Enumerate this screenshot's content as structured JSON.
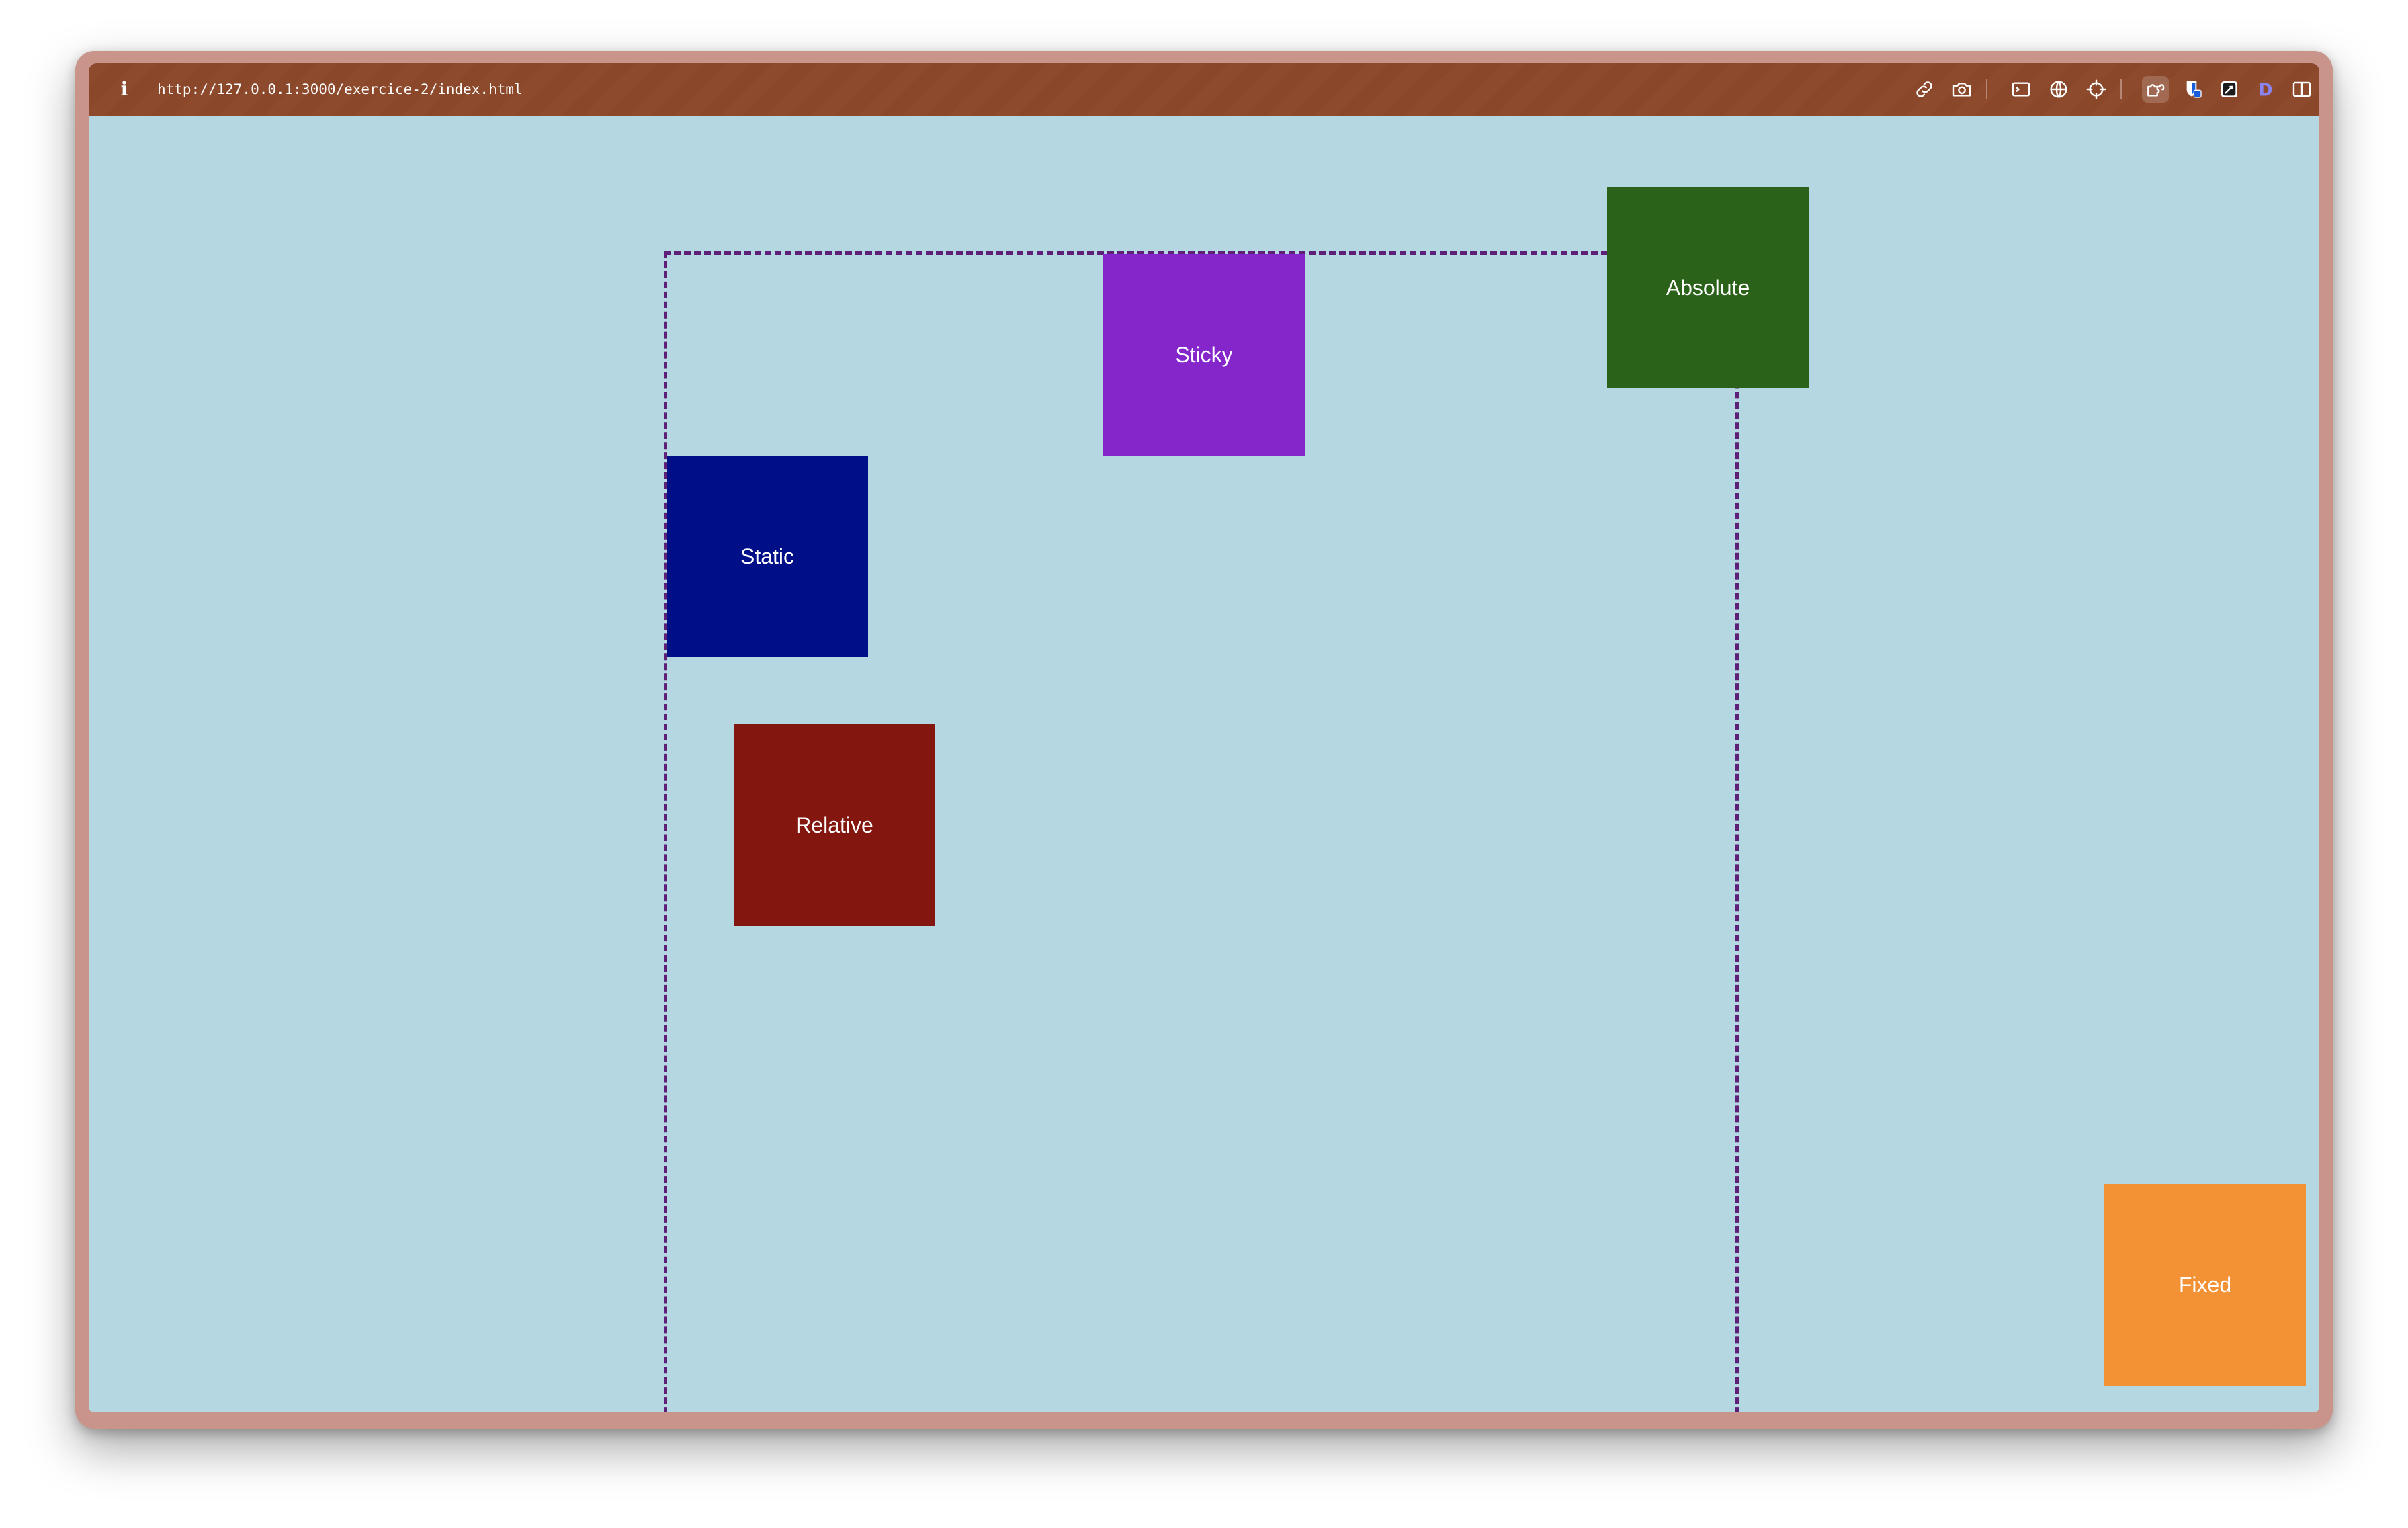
{
  "browser": {
    "url": "http://127.0.0.1:3000/exercice-2/index.html",
    "info_glyph": "i",
    "toolbar_icons": [
      "link-icon",
      "camera-icon",
      "terminal-icon",
      "globe-icon",
      "crosshair-icon",
      "extensions-icon",
      "bitwarden-icon",
      "editor-icon",
      "d-icon",
      "sidebar-icon"
    ],
    "d_icon_letter": "D",
    "toolbar_color": "#8e4a2c",
    "frame_color": "#c9948a"
  },
  "page": {
    "background": "#b5d7e2",
    "container_border_color": "#5d1f77",
    "boxes": {
      "static": {
        "label": "Static",
        "color": "#000f87"
      },
      "relative": {
        "label": "Relative",
        "color": "#83170f"
      },
      "sticky": {
        "label": "Sticky",
        "color": "#8526ca"
      },
      "absolute": {
        "label": "Absolute",
        "color": "#2a6219"
      },
      "fixed": {
        "label": "Fixed",
        "color": "#f29235"
      }
    }
  }
}
